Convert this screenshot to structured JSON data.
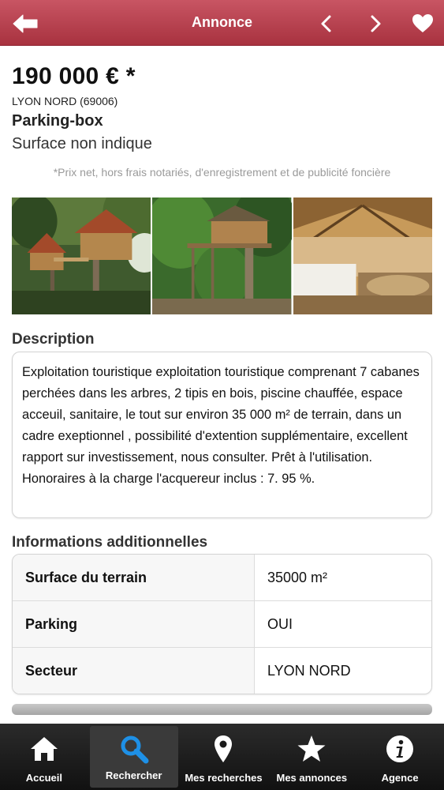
{
  "header": {
    "title": "Annonce",
    "icons": {
      "back": "back-arrow-icon",
      "prev": "chevron-left-icon",
      "next": "chevron-right-icon",
      "favorite": "heart-icon"
    },
    "colors": {
      "bar": "#b43e4c"
    }
  },
  "listing": {
    "price": "190 000 € *",
    "location": "LYON NORD (69006)",
    "type": "Parking-box",
    "surface": "Surface non indique",
    "disclaimer": "*Prix net, hors frais notariés, d'enregistrement et de publicité foncière"
  },
  "photos": [
    {
      "name": "photo-treehouse-1"
    },
    {
      "name": "photo-treehouse-2"
    },
    {
      "name": "photo-interior"
    }
  ],
  "description": {
    "heading": "Description",
    "text": "Exploitation touristique exploitation touristique comprenant 7 cabanes perchées dans les arbres, 2 tipis en bois, piscine chauffée, espace acceuil, sanitaire, le tout sur environ 35 000 m² de terrain, dans un cadre exeptionnel , possibilité d'extention supplémentaire, excellent rapport sur investissement, nous consulter. Prêt à l'utilisation. Honoraires à la charge l'acquereur inclus : 7. 95 %."
  },
  "info": {
    "heading": "Informations additionnelles",
    "rows": [
      {
        "label": "Surface du terrain",
        "value": "35000 m²"
      },
      {
        "label": "Parking",
        "value": "OUI"
      },
      {
        "label": "Secteur",
        "value": "LYON NORD"
      }
    ]
  },
  "tabbar": {
    "active": "Rechercher",
    "items": [
      {
        "label": "Accueil",
        "icon": "home-icon"
      },
      {
        "label": "Rechercher",
        "icon": "search-icon"
      },
      {
        "label": "Mes recherches",
        "icon": "map-pin-icon"
      },
      {
        "label": "Mes annonces",
        "icon": "star-icon"
      },
      {
        "label": "Agence",
        "icon": "info-icon"
      }
    ]
  }
}
